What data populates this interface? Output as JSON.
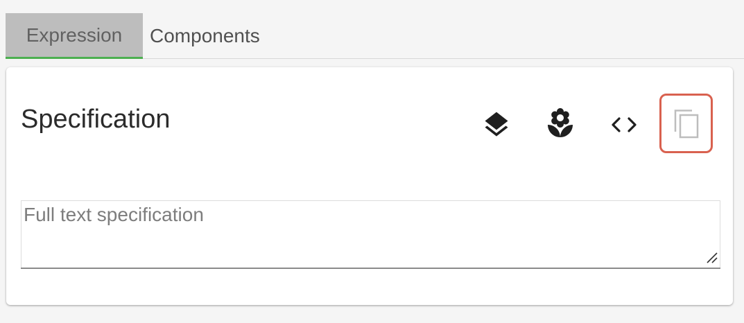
{
  "tabs": [
    {
      "label": "Expression",
      "active": true
    },
    {
      "label": "Components",
      "active": false
    }
  ],
  "card": {
    "title": "Specification",
    "toolbar": {
      "icons": [
        "layers-icon",
        "flower-icon",
        "code-icon",
        "copy-icon"
      ],
      "highlighted": "copy-icon",
      "highlight_color": "#d9614f"
    },
    "spec_field": {
      "value": "",
      "placeholder": "Full text specification"
    }
  },
  "colors": {
    "active_tab_bg": "#bdbdbd",
    "active_tab_indicator": "#4caf50",
    "page_bg": "#f5f5f5"
  }
}
